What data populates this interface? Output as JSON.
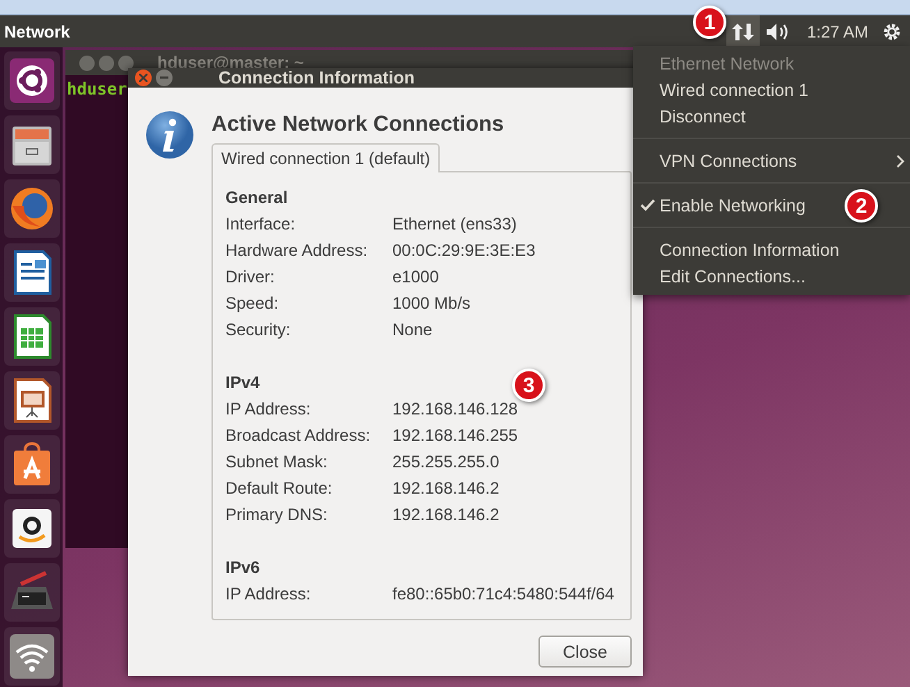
{
  "top_panel": {
    "title": "Network",
    "clock": "1:27 AM"
  },
  "launcher": {
    "items": [
      {
        "kind": "ubuntu"
      },
      {
        "kind": "files"
      },
      {
        "kind": "browser"
      },
      {
        "kind": "writer"
      },
      {
        "kind": "calc"
      },
      {
        "kind": "impress"
      },
      {
        "kind": "software"
      },
      {
        "kind": "shop"
      },
      {
        "kind": "tools"
      },
      {
        "kind": "wifi"
      }
    ]
  },
  "terminal": {
    "title": "hduser@master: ~",
    "prompt": "hduser"
  },
  "dialog": {
    "title": "Connection Information",
    "heading": "Active Network Connections",
    "tabs": [
      {
        "label": "Wired connection 1 (default)",
        "selected": true
      }
    ],
    "sections": [
      {
        "title": "General",
        "rows": [
          {
            "label": "Interface:",
            "value": "Ethernet (ens33)"
          },
          {
            "label": "Hardware Address:",
            "value": "00:0C:29:9E:3E:E3"
          },
          {
            "label": "Driver:",
            "value": "e1000"
          },
          {
            "label": "Speed:",
            "value": "1000 Mb/s"
          },
          {
            "label": "Security:",
            "value": "None"
          }
        ]
      },
      {
        "title": "IPv4",
        "rows": [
          {
            "label": "IP Address:",
            "value": "192.168.146.128"
          },
          {
            "label": "Broadcast Address:",
            "value": "192.168.146.255"
          },
          {
            "label": "Subnet Mask:",
            "value": "255.255.255.0"
          },
          {
            "label": "Default Route:",
            "value": "192.168.146.2"
          },
          {
            "label": "Primary DNS:",
            "value": "192.168.146.2"
          }
        ]
      },
      {
        "title": "IPv6",
        "rows": [
          {
            "label": "IP Address:",
            "value": "fe80::65b0:71c4:5480:544f/64"
          }
        ]
      }
    ],
    "close_button": "Close"
  },
  "network_menu": {
    "items": [
      {
        "kind": "item",
        "label": "Ethernet Network",
        "disabled": true
      },
      {
        "kind": "item",
        "label": "Wired connection 1",
        "disabled": false
      },
      {
        "kind": "item",
        "label": "Disconnect",
        "disabled": false
      },
      {
        "kind": "separator"
      },
      {
        "kind": "submenu",
        "label": "VPN Connections",
        "disabled": false
      },
      {
        "kind": "separator"
      },
      {
        "kind": "check",
        "label": "Enable Networking",
        "disabled": false,
        "checked": true
      },
      {
        "kind": "separator"
      },
      {
        "kind": "item",
        "label": "Connection Information",
        "disabled": false
      },
      {
        "kind": "item",
        "label": "Edit Connections...",
        "disabled": false
      }
    ]
  },
  "callouts": [
    {
      "label": "1"
    },
    {
      "label": "2"
    },
    {
      "label": "3"
    }
  ]
}
